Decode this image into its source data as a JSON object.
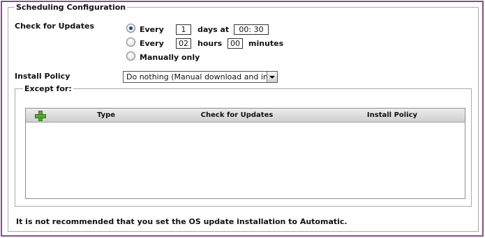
{
  "scheduling": {
    "legend": "Scheduling Configuration",
    "check_updates_label": "Check for Updates",
    "option_every_days": {
      "label": "Every",
      "value": "1",
      "suffix": "days at",
      "time": "00: 30",
      "selected": true
    },
    "option_every_hours": {
      "label": "Every",
      "hours": "02",
      "hours_label": "hours",
      "minutes": "00",
      "minutes_label": "minutes",
      "selected": false
    },
    "option_manual": {
      "label": "Manually only",
      "selected": false
    },
    "install_policy_label": "Install Policy",
    "install_policy_value": "Do nothing (Manual download and install)",
    "except": {
      "legend": "Except for:",
      "columns": [
        "Type",
        "Check for Updates",
        "Install Policy"
      ],
      "add_icon": "plus-icon",
      "rows": []
    },
    "note": "It is not recommended that you set the OS update installation to Automatic."
  },
  "colors": {
    "frame_border": "#8a4c8e",
    "group_border": "#a9a9a9",
    "radio_selected": "#1d3f8e",
    "add_icon": "#5aa832"
  }
}
